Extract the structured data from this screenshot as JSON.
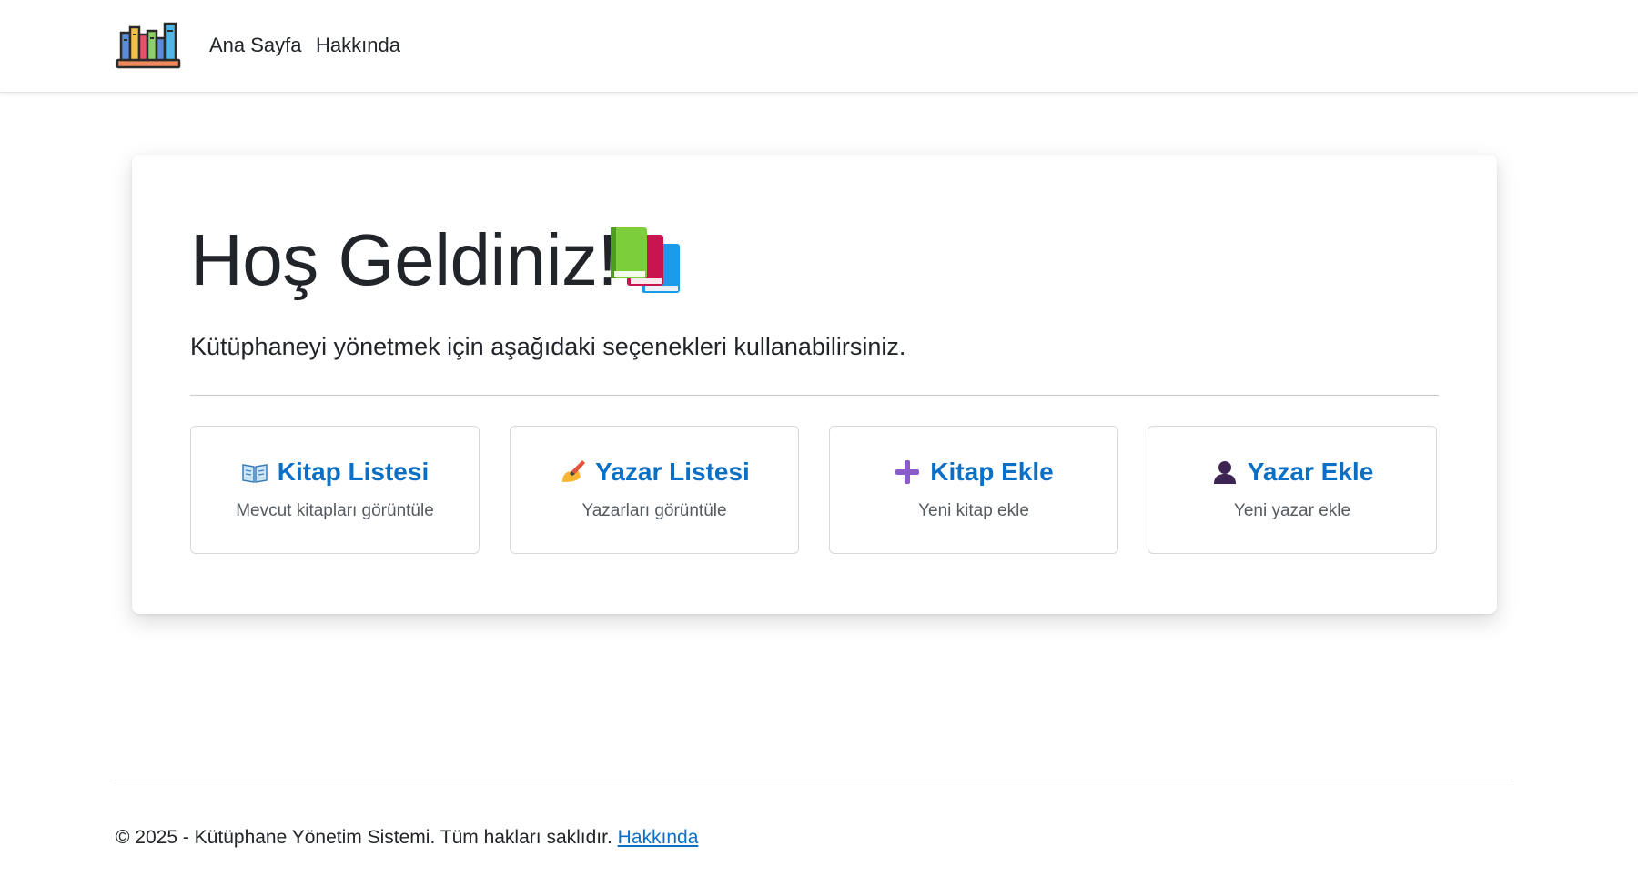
{
  "navbar": {
    "logo_icon": "bookshelf-icon",
    "links": [
      {
        "label": "Ana Sayfa"
      },
      {
        "label": "Hakkında"
      }
    ]
  },
  "hero": {
    "title": "Hoş Geldiniz!",
    "title_icon": "books-emoji-icon",
    "lead": "Kütüphaneyi yönetmek için aşağıdaki seçenekleri kullanabilirsiniz."
  },
  "options": [
    {
      "icon": "open-book-icon",
      "title": "Kitap Listesi",
      "description": "Mevcut kitapları görüntüle"
    },
    {
      "icon": "writing-hand-icon",
      "title": "Yazar Listesi",
      "description": "Yazarları görüntüle"
    },
    {
      "icon": "plus-icon",
      "title": "Kitap Ekle",
      "description": "Yeni kitap ekle"
    },
    {
      "icon": "person-icon",
      "title": "Yazar Ekle",
      "description": "Yeni yazar ekle"
    }
  ],
  "footer": {
    "text": "© 2025 - Kütüphane Yönetim Sistemi. Tüm hakları saklıdır.",
    "link_label": "Hakkında"
  },
  "colors": {
    "link": "#0b6fc6",
    "text": "#212529",
    "muted": "#555b61"
  }
}
